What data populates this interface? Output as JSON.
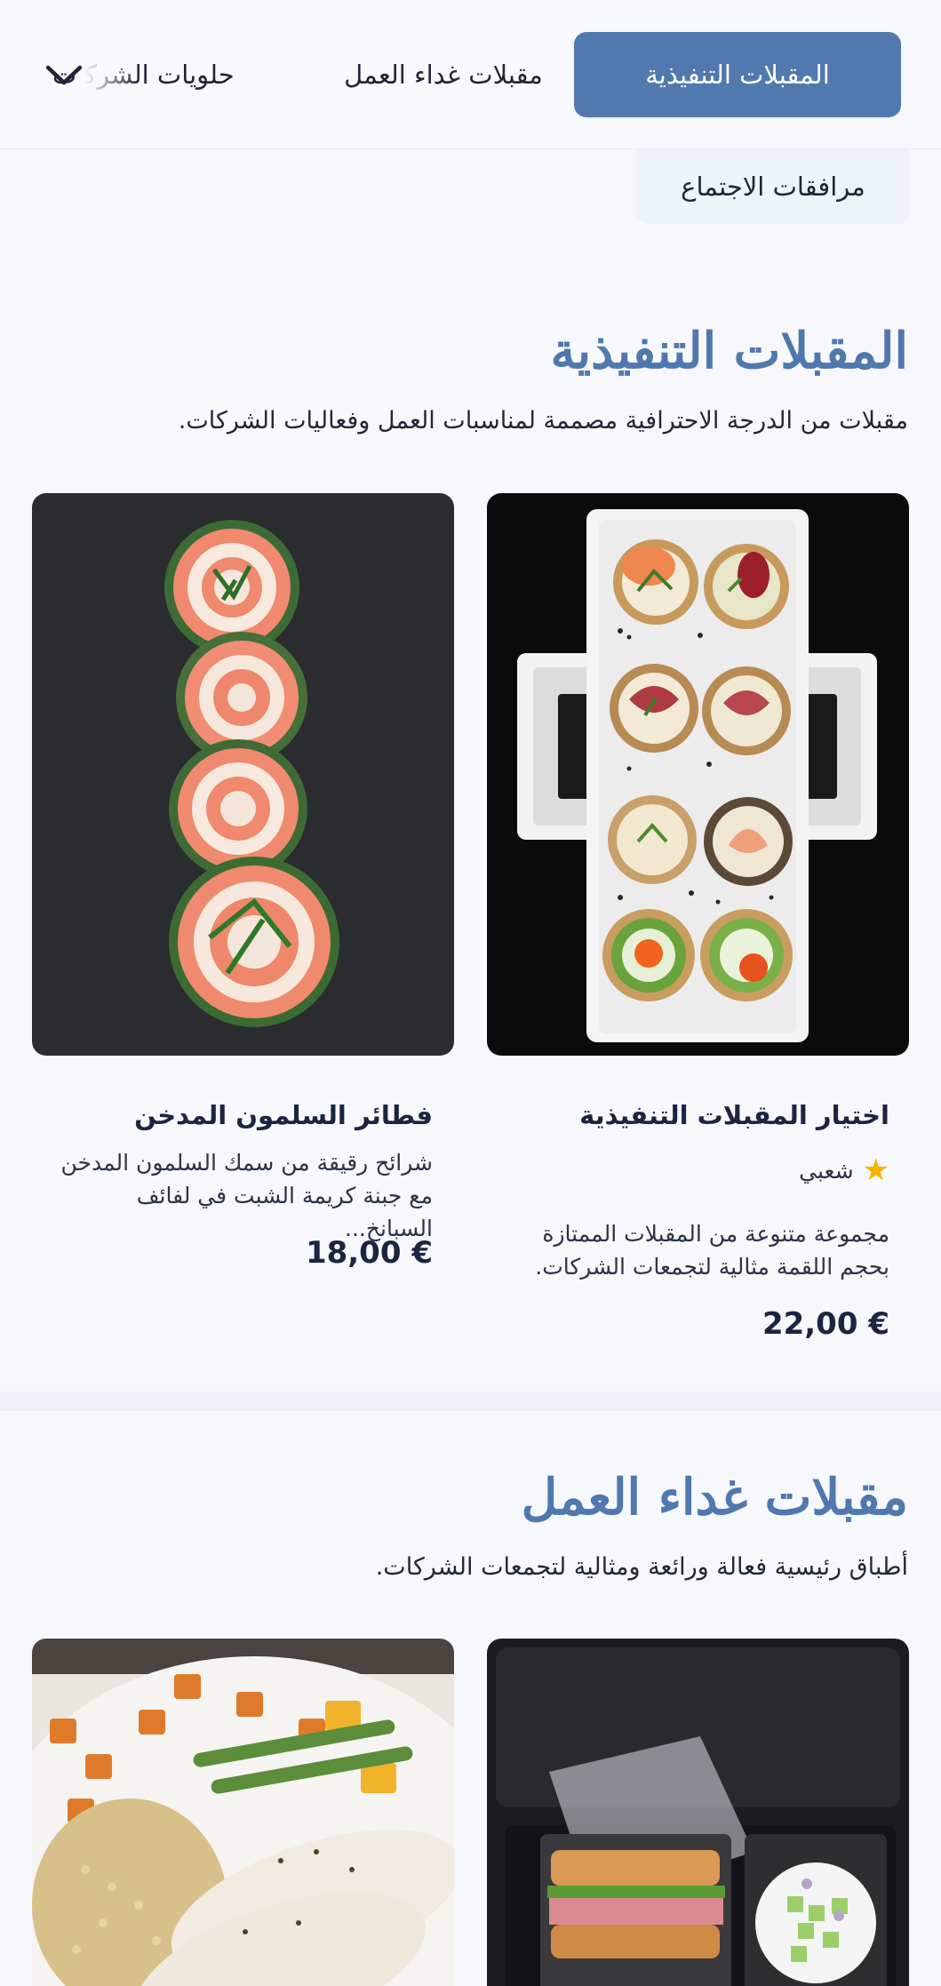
{
  "nav": {
    "tabs": [
      {
        "label": "المقبلات التنفيذية",
        "active": true
      },
      {
        "label": "مقبلات غداء العمل",
        "active": false
      },
      {
        "label": "حلويات الشركات",
        "active": false
      }
    ],
    "secondary_tab": "مرافقات الاجتماع",
    "expand_icon": "chevron-down-icon",
    "accent_color": "#5279ad"
  },
  "sections": [
    {
      "title": "المقبلات التنفيذية",
      "description": "مقبلات من الدرجة الاحترافية مصممة لمناسبات العمل وفعاليات الشركات.",
      "products": [
        {
          "title": "اختيار المقبلات التنفيذية",
          "badge": "شعبي",
          "description": "مجموعة متنوعة من المقبلات الممتازة بحجم اللقمة مثالية لتجمعات الشركات.",
          "price": "22,00 €"
        },
        {
          "title": "فطائر السلمون المدخن",
          "description": "شرائح رقيقة من سمك السلمون المدخن مع جبنة كريمة الشبت في لفائف السبانخ...",
          "price": "18,00 €"
        }
      ]
    },
    {
      "title": "مقبلات غداء العمل",
      "description": "أطباق رئيسية فعالة ورائعة ومثالية لتجمعات الشركات."
    }
  ]
}
